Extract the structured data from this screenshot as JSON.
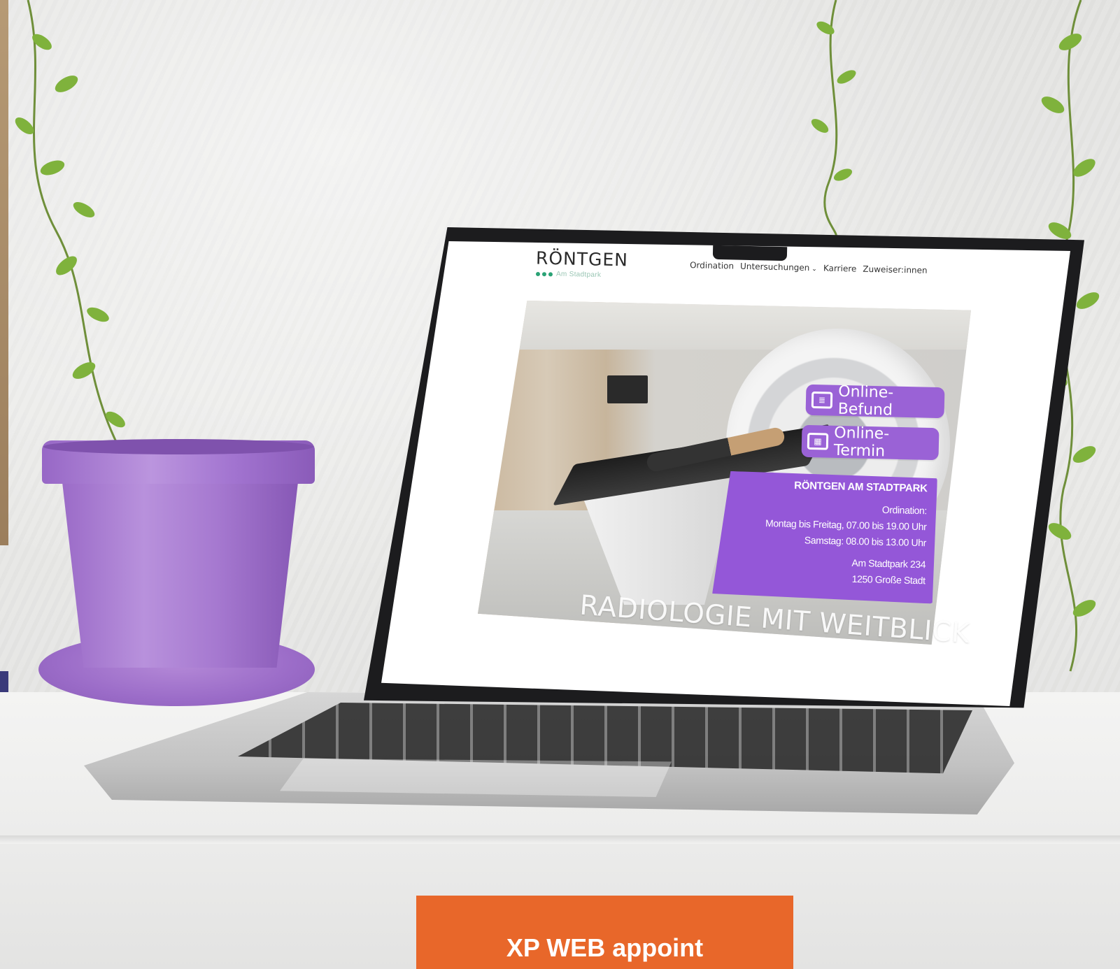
{
  "site": {
    "logo_title": "RÖNTGEN",
    "logo_subtitle": "Am Stadtpark",
    "nav": [
      {
        "label": "Ordination"
      },
      {
        "label": "Untersuchungen"
      },
      {
        "label": "Karriere"
      },
      {
        "label": "Zuweiser:innen"
      }
    ],
    "dropdown_chevron": "⌄"
  },
  "hero": {
    "buttons": {
      "online_befund": "Online-Befund",
      "online_termin": "Online-Termin"
    },
    "info": {
      "title": "RÖNTGEN AM STADTPARK",
      "ordination_label": "Ordination:",
      "hours_weekday": "Montag bis Freitag, 07.00 bis 19.00 Uhr",
      "hours_saturday": "Samstag: 08.00 bis 13.00 Uhr",
      "address_street": "Am Stadtpark 234",
      "address_city": "1250 Große Stadt"
    },
    "slogan": "RADIOLOGIE MIT WEITBLICK"
  },
  "cta": {
    "label": "XP WEB appoint"
  },
  "colors": {
    "accent_purple": "#9457d8",
    "brand_green": "#2aa275",
    "cta_orange": "#e8672a",
    "pot_purple": "#a679d0"
  },
  "icons": {
    "befund_icon": "document-list-icon",
    "termin_icon": "calendar-icon"
  }
}
